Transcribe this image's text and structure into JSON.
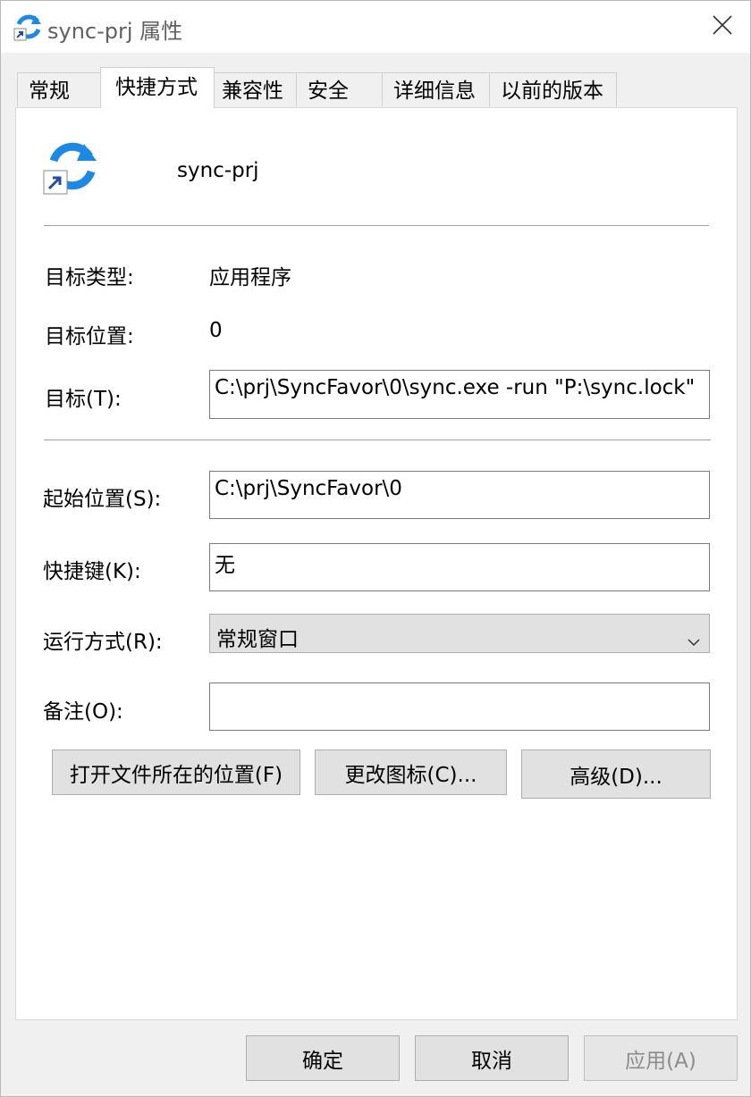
{
  "window": {
    "title": "sync-prj 属性"
  },
  "tabs": [
    {
      "label": "常规"
    },
    {
      "label": "快捷方式"
    },
    {
      "label": "兼容性"
    },
    {
      "label": "安全"
    },
    {
      "label": "详细信息"
    },
    {
      "label": "以前的版本"
    }
  ],
  "shortcut": {
    "name": "sync-prj",
    "target_type_label": "目标类型:",
    "target_type_value": "应用程序",
    "target_location_label": "目标位置:",
    "target_location_value": "0",
    "target_label": "目标(T):",
    "target_value": "C:\\prj\\SyncFavor\\0\\sync.exe -run \"P:\\sync.lock\"",
    "start_in_label": "起始位置(S):",
    "start_in_value": "C:\\prj\\SyncFavor\\0",
    "hotkey_label": "快捷键(K):",
    "hotkey_value": "无",
    "run_label": "运行方式(R):",
    "run_value": "常规窗口",
    "comment_label": "备注(O):",
    "comment_value": "",
    "open_location_button": "打开文件所在的位置(F)",
    "change_icon_button": "更改图标(C)...",
    "advanced_button": "高级(D)..."
  },
  "footer": {
    "ok_button": "确定",
    "cancel_button": "取消",
    "apply_button": "应用(A)"
  },
  "colors": {
    "icon_blue": "#1e88e5",
    "panel_bg": "#ffffff",
    "window_bg": "#f0f0f0"
  },
  "icons": {
    "title": "sync-arrows-icon",
    "close": "close-icon",
    "app": "sync-arrows-icon",
    "shortcut_overlay": "shortcut-arrow-icon",
    "dropdown": "chevron-down-icon"
  }
}
